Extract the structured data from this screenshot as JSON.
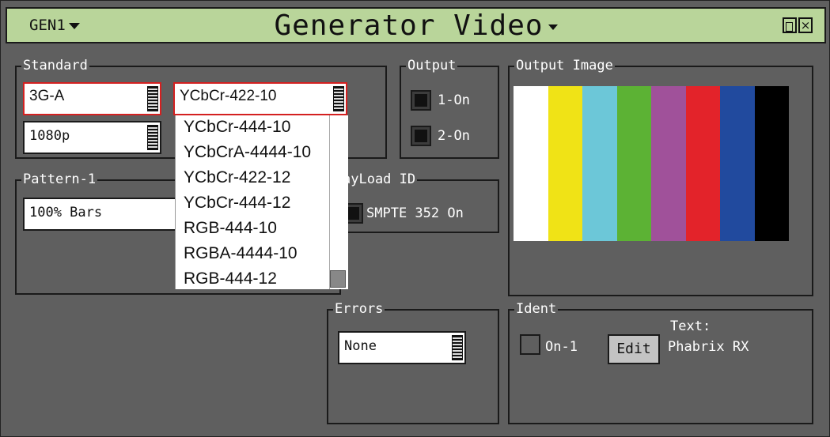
{
  "window": {
    "generator_selector": "GEN1",
    "title": "Generator Video"
  },
  "standard": {
    "label": "Standard",
    "rate": "3G-A",
    "format": "1080p",
    "sampling": "YCbCr-422-10"
  },
  "sampling_dropdown": {
    "options": [
      "YCbCr-444-10",
      "YCbCrA-4444-10",
      "YCbCr-422-12",
      "YCbCr-444-12",
      "RGB-444-10",
      "RGBA-4444-10",
      "RGB-444-12"
    ]
  },
  "output": {
    "label": "Output",
    "items": [
      {
        "label": "1-On",
        "checked": true
      },
      {
        "label": "2-On",
        "checked": true
      }
    ]
  },
  "output_image": {
    "label": "Output Image",
    "bar_colors": [
      "#ffffff",
      "#f0e316",
      "#6cc7d8",
      "#5cb234",
      "#a0519a",
      "#e3232a",
      "#214a9e",
      "#000000"
    ]
  },
  "pattern": {
    "label": "Pattern-1",
    "value": "100% Bars"
  },
  "payload": {
    "label": "ayLoad ID",
    "checkbox_label": "SMPTE 352 On",
    "checked": true
  },
  "errors": {
    "label": "Errors",
    "value": "None"
  },
  "ident": {
    "label": "Ident",
    "checkbox_label": "On-1",
    "checked": false,
    "edit_label": "Edit",
    "text_label": "Text:",
    "text_value": "Phabrix RX"
  }
}
